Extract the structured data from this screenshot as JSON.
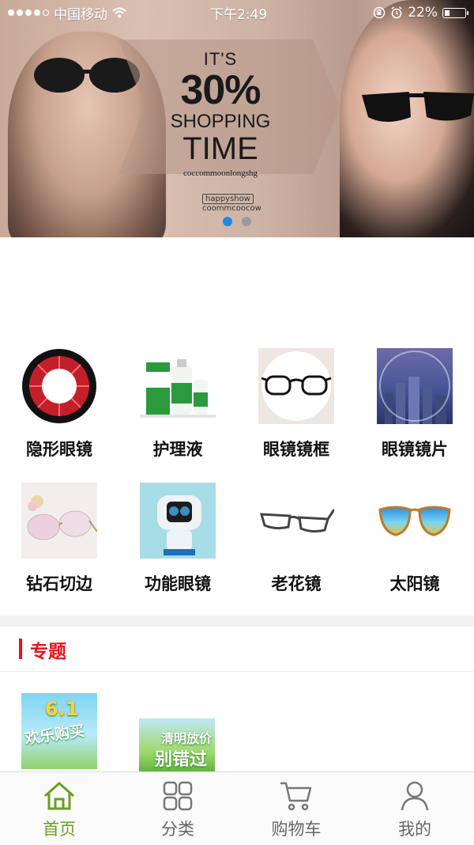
{
  "status_bar": {
    "carrier": "中国移动",
    "time": "下午2:49",
    "battery": "22%",
    "battery_level": 0.22
  },
  "banner": {
    "line1": "IT'S",
    "line2": "30%",
    "line3": "SHOPPING",
    "line4": "TIME",
    "line5": "coccommoonlongshg",
    "tag1": "happyshow",
    "tag2": "coommcoocow",
    "slide_count": 2,
    "active_slide": 1
  },
  "categories": [
    {
      "label": "隐形眼镜",
      "icon": "contact-lens-icon"
    },
    {
      "label": "护理液",
      "icon": "care-solution-icon"
    },
    {
      "label": "眼镜镜框",
      "icon": "eyeglass-frame-icon"
    },
    {
      "label": "眼镜镜片",
      "icon": "lens-icon"
    },
    {
      "label": "钻石切边",
      "icon": "diamond-cut-glasses-icon"
    },
    {
      "label": "功能眼镜",
      "icon": "vision-device-icon"
    },
    {
      "label": "老花镜",
      "icon": "reading-glasses-icon"
    },
    {
      "label": "太阳镜",
      "icon": "sunglasses-icon"
    }
  ],
  "topics": {
    "title": "专题",
    "items": [
      {
        "text_top": "6.1",
        "text_bottom": "欢乐购买"
      },
      {
        "text_top": "清明放价",
        "text_bottom": "别错过"
      }
    ]
  },
  "tabbar": {
    "items": [
      {
        "label": "首页",
        "icon": "home-icon",
        "active": true
      },
      {
        "label": "分类",
        "icon": "category-icon",
        "active": false
      },
      {
        "label": "购物车",
        "icon": "cart-icon",
        "active": false
      },
      {
        "label": "我的",
        "icon": "user-icon",
        "active": false
      }
    ]
  },
  "colors": {
    "accent": "#6b9e1f",
    "topic_red": "#e8141c",
    "indicator_active": "#1e88e5"
  }
}
